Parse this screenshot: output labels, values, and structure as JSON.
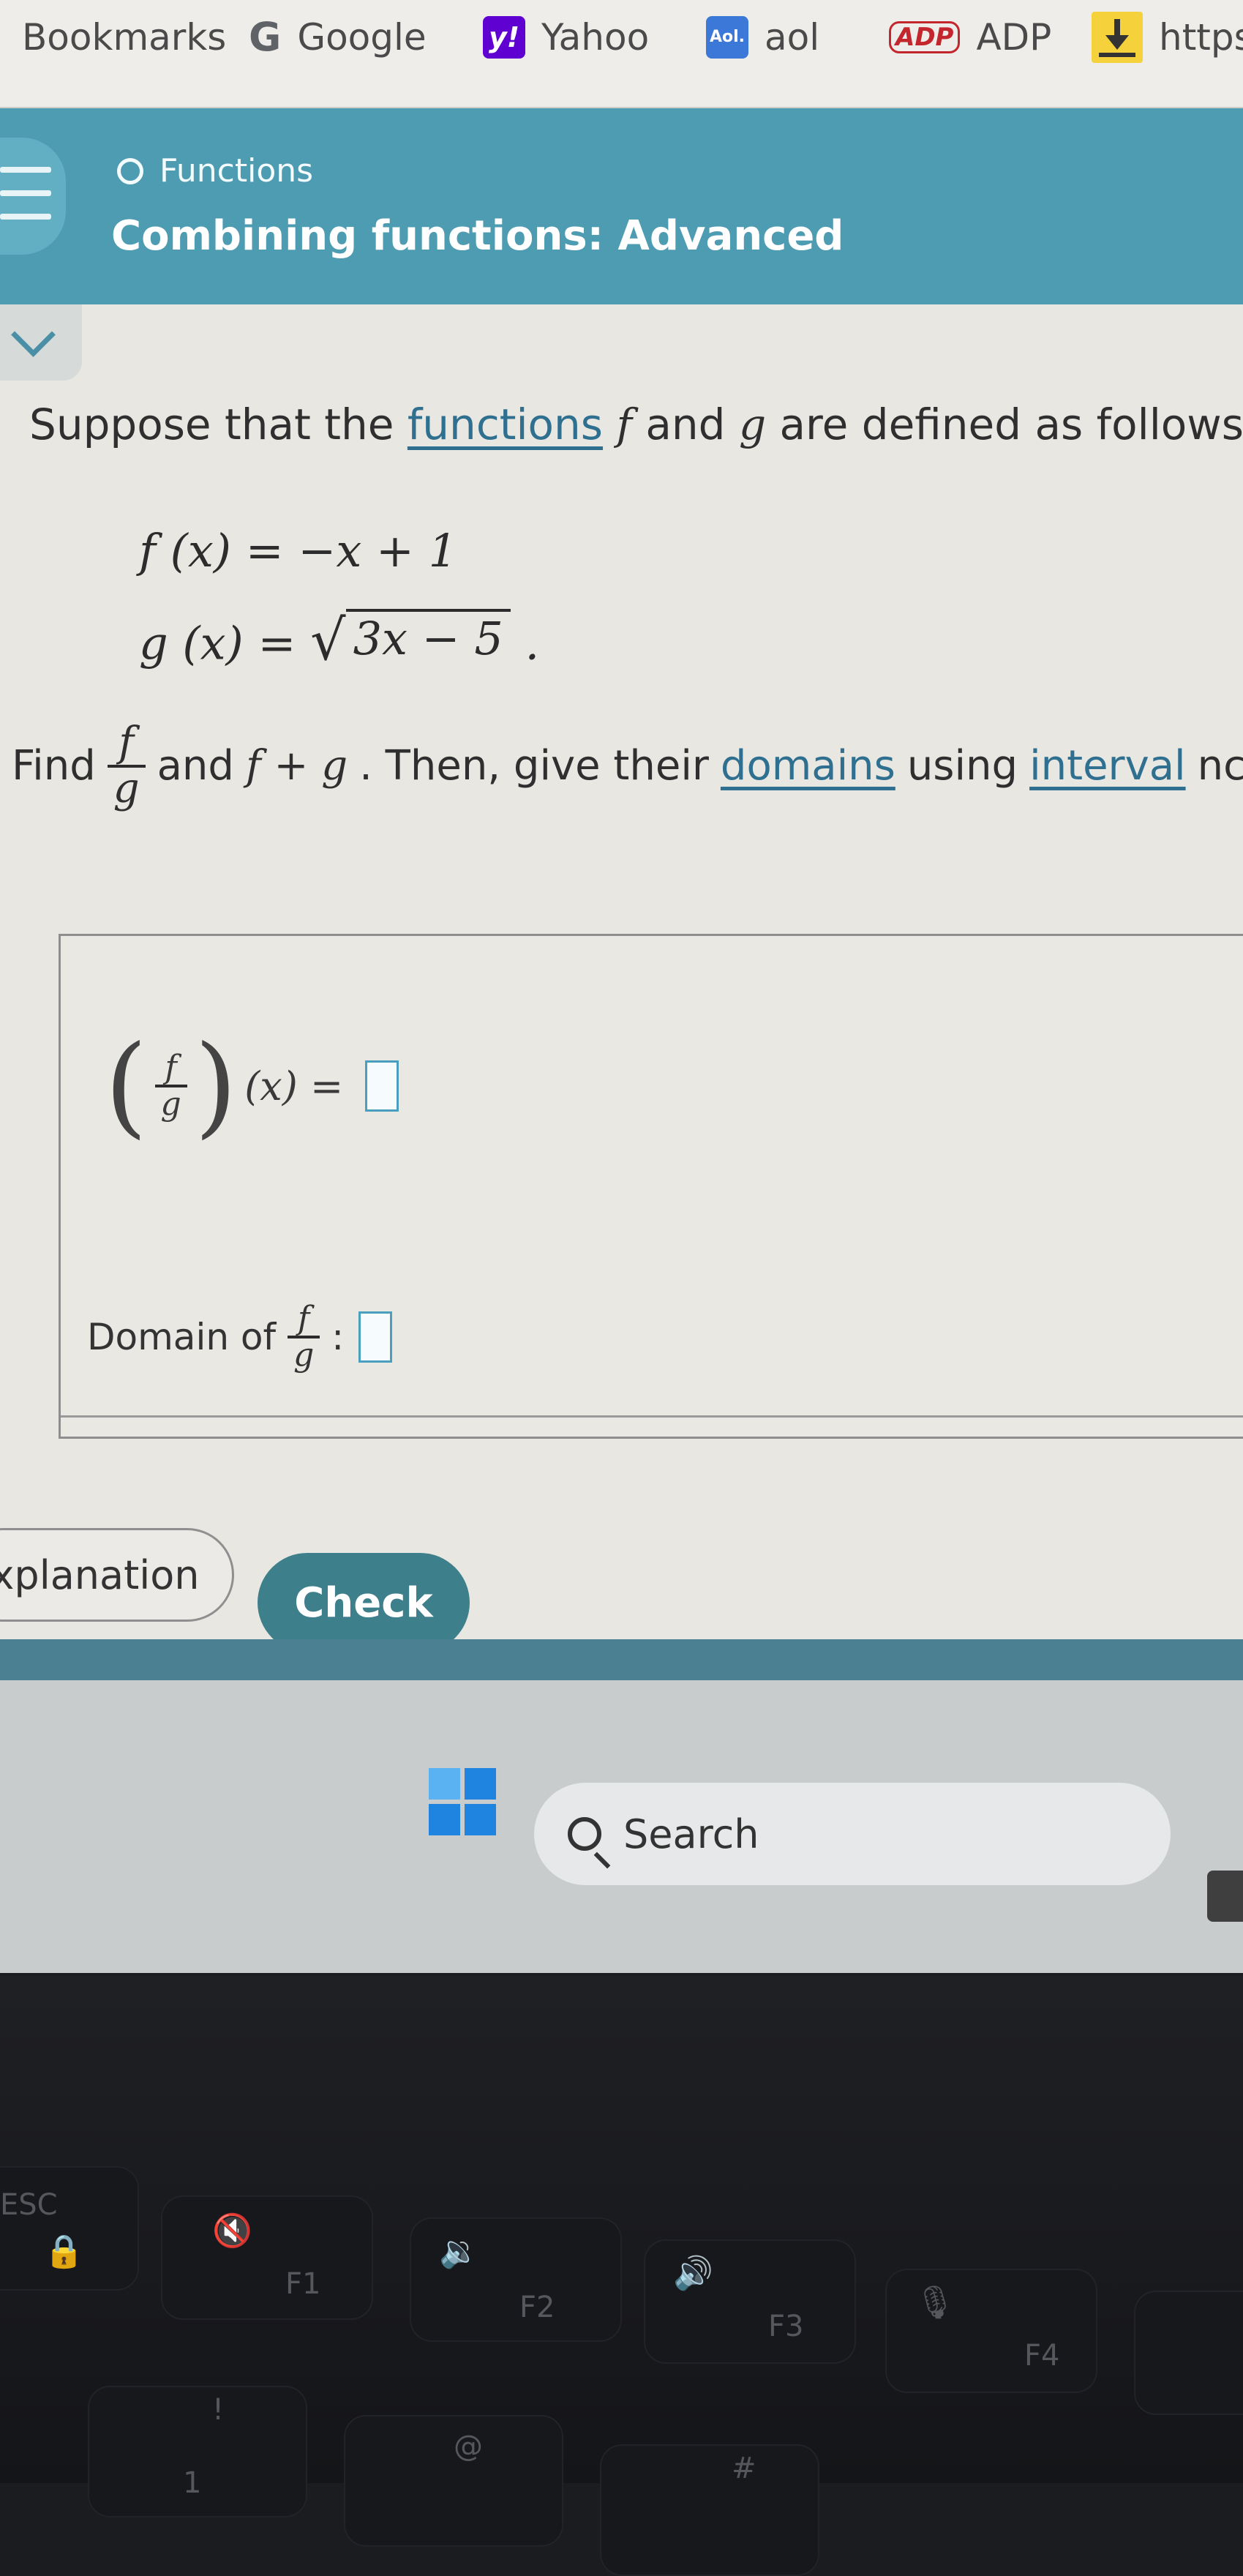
{
  "bookmarks_bar": {
    "items": [
      {
        "label": "Bookmarks",
        "icon": ""
      },
      {
        "label": "Google",
        "icon": "google-icon",
        "glyph": "G"
      },
      {
        "label": "Yahoo",
        "icon": "yahoo-icon",
        "glyph": "y!"
      },
      {
        "label": "aol",
        "icon": "aol-icon",
        "glyph": "Aol."
      },
      {
        "label": "ADP",
        "icon": "adp-icon",
        "glyph": "ADP"
      },
      {
        "label": "https",
        "icon": "download-icon"
      }
    ]
  },
  "header": {
    "breadcrumb": "Functions",
    "title": "Combining functions: Advanced",
    "accent_color": "#4e9cb2"
  },
  "problem": {
    "intro_before": "Suppose that the",
    "intro_link": "functions",
    "intro_f": "f",
    "intro_and": "and",
    "intro_g": "g",
    "intro_after": "are defined as follows.",
    "f_def": "f (x) = −x + 1",
    "g_lhs": "g (x) =",
    "g_radicand": "3x − 5",
    "g_end": ".",
    "find_label": "Find",
    "frac_num": "f",
    "frac_den": "g",
    "find_and": "and",
    "find_sum": "f + g",
    "find_rest": ". Then, give their",
    "domains_link": "domains",
    "using": "using",
    "interval_link": "interval",
    "cut_text": "nc"
  },
  "answer": {
    "expr_suffix": "(x) =",
    "domain_label": "Domain of",
    "domain_colon": ":"
  },
  "buttons": {
    "explanation": "xplanation",
    "check": "Check",
    "check_color": "#3e7f8c"
  },
  "taskbar": {
    "search_label": "Search"
  },
  "keyboard": {
    "esc": "ESC",
    "f1": "F1",
    "f2": "F2",
    "f3": "F3",
    "f4": "F4",
    "k1_top": "!",
    "k1": "1",
    "k2_top": "@",
    "k3_top": "#"
  }
}
